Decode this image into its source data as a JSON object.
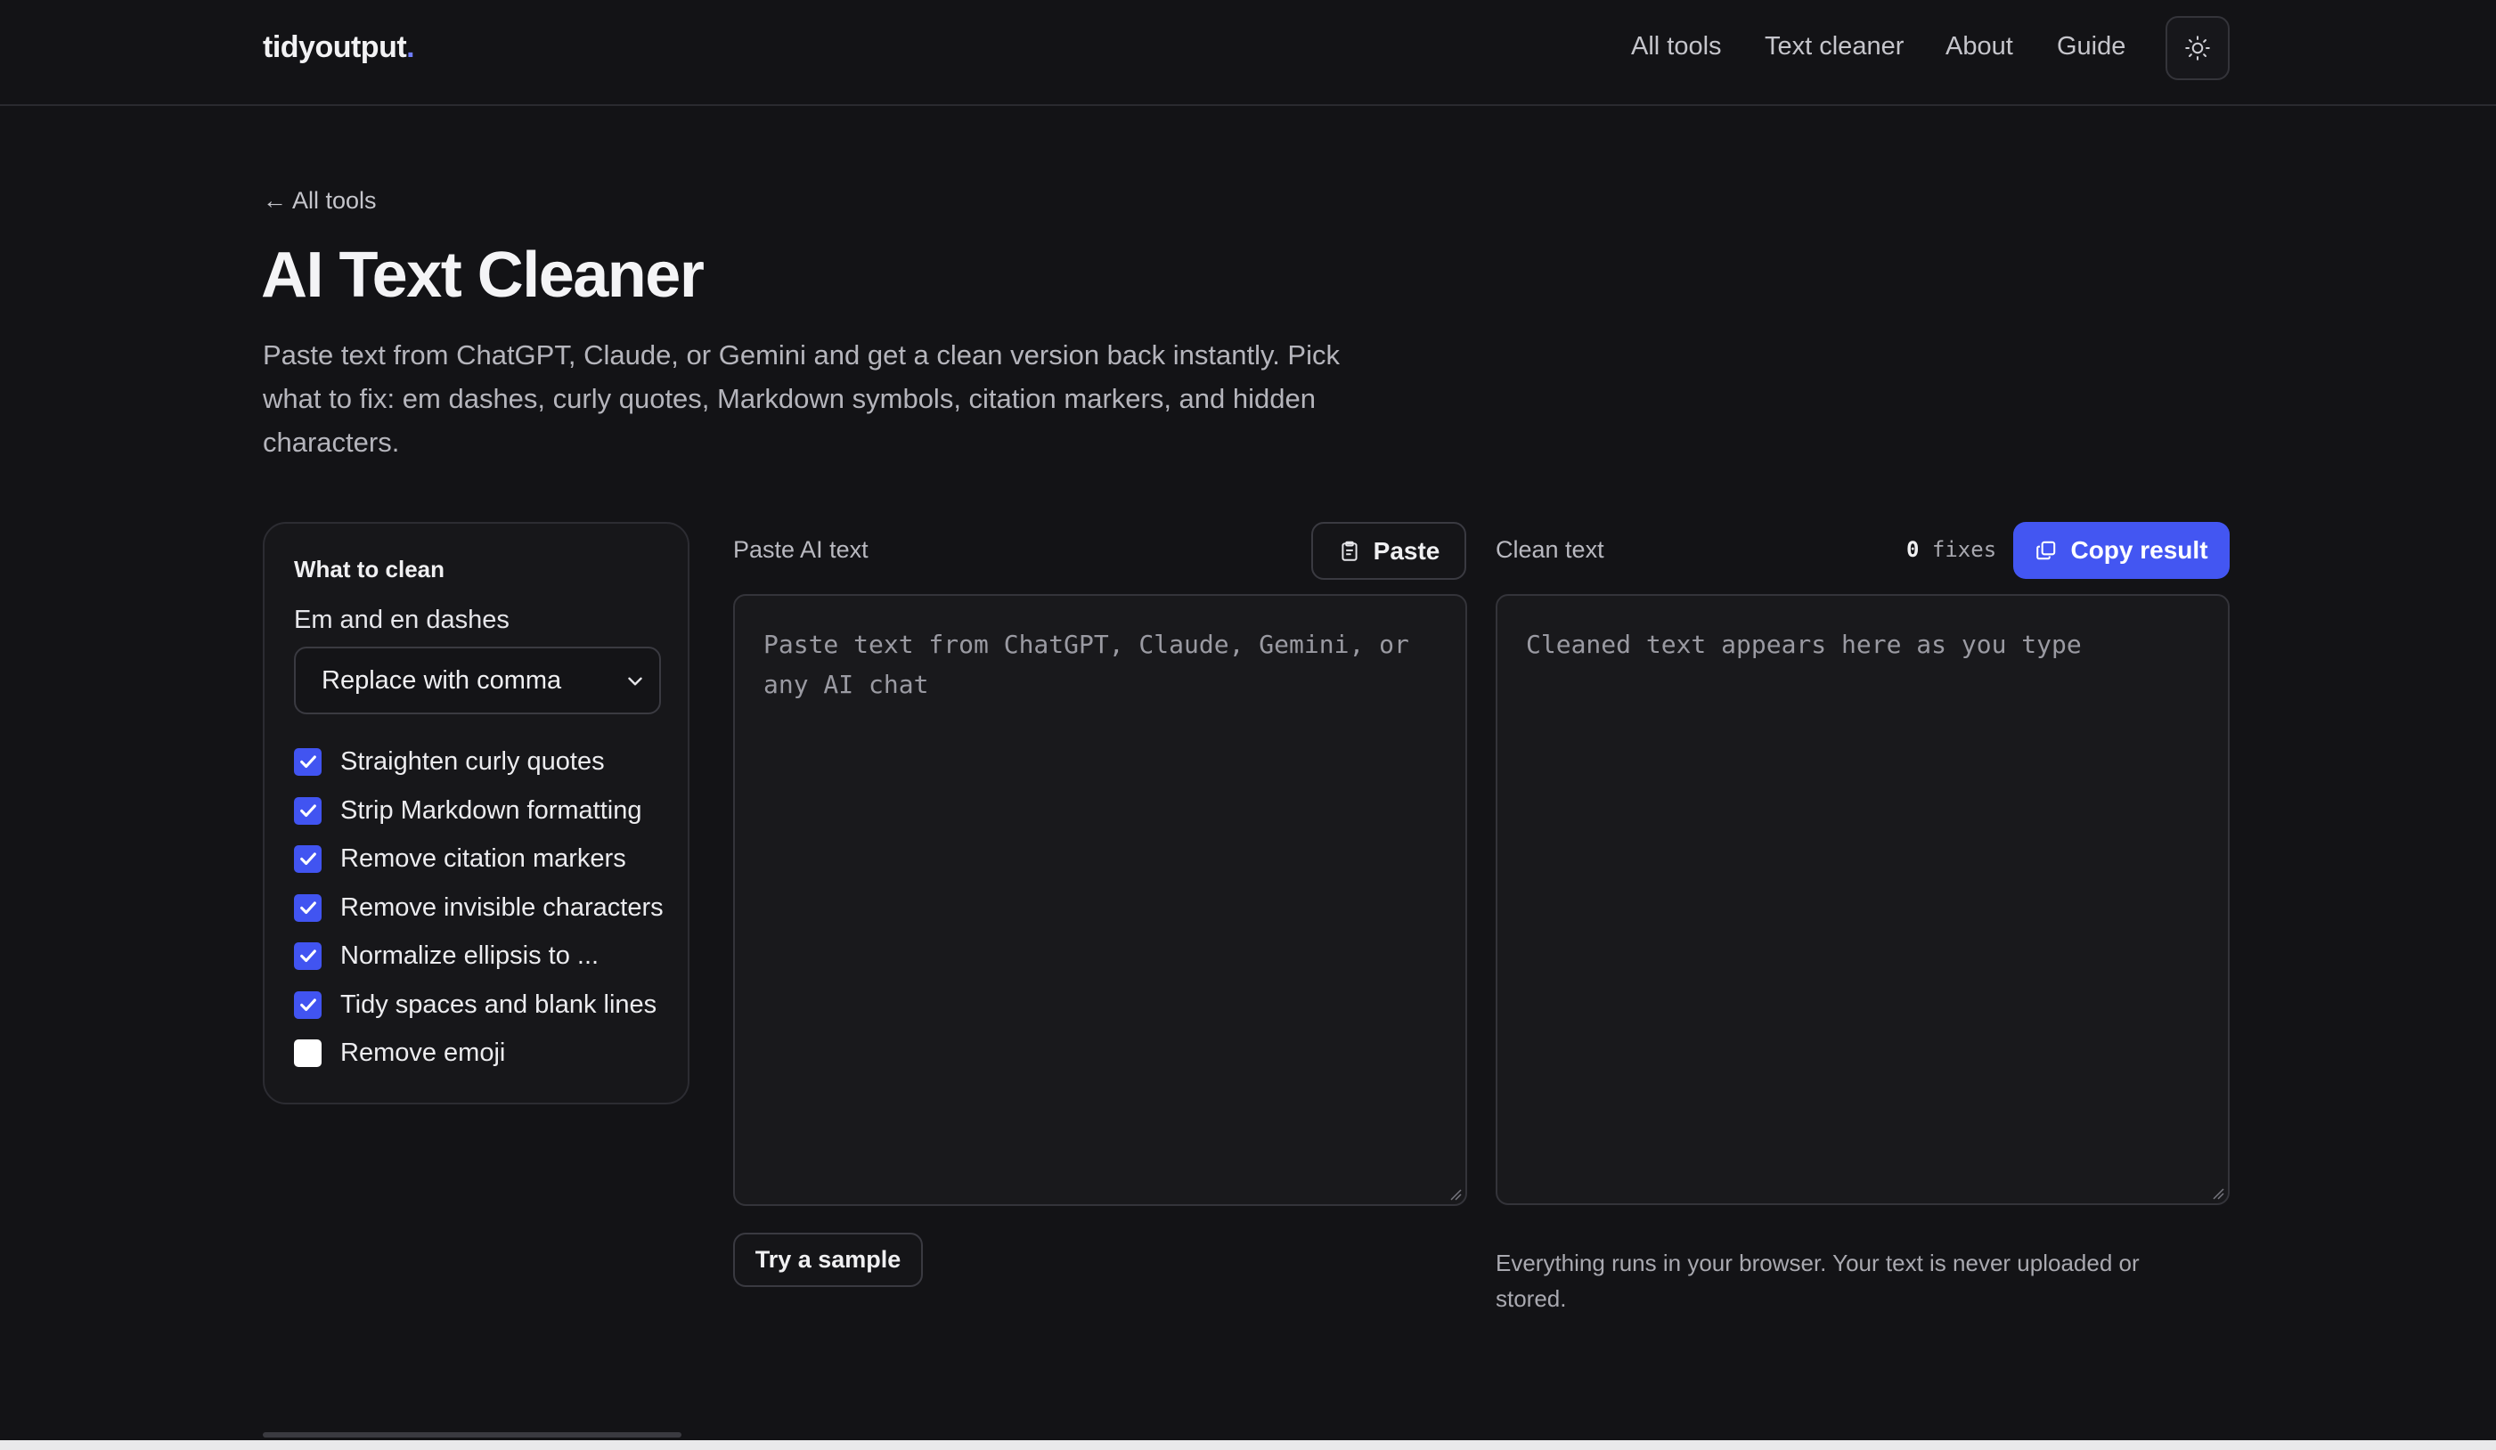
{
  "header": {
    "logo": "tidyoutput",
    "logo_dot": ".",
    "nav": [
      "All tools",
      "Text cleaner",
      "About",
      "Guide"
    ],
    "theme_toggle_icon": "sun-icon"
  },
  "intro": {
    "back_link": "← All tools",
    "title": "AI Text Cleaner",
    "description": "Paste text from ChatGPT, Claude, or Gemini and get a clean version back instantly. Pick what to fix: em dashes, curly quotes, Markdown symbols, citation markers, and hidden characters."
  },
  "options": {
    "heading": "What to clean",
    "dash_label": "Em and en dashes",
    "dash_selected": "Replace with comma",
    "items": [
      {
        "label": "Straighten curly quotes",
        "checked": true
      },
      {
        "label": "Strip Markdown formatting",
        "checked": true
      },
      {
        "label": "Remove citation markers",
        "checked": true
      },
      {
        "label": "Remove invisible characters",
        "checked": true
      },
      {
        "label": "Normalize ellipsis to ...",
        "checked": true
      },
      {
        "label": "Tidy spaces and blank lines",
        "checked": true
      },
      {
        "label": "Remove emoji",
        "checked": false
      }
    ]
  },
  "input": {
    "label": "Paste AI text",
    "paste_button": "Paste",
    "placeholder": "Paste text from ChatGPT, Claude, Gemini, or any AI chat",
    "sample_button": "Try a sample"
  },
  "output": {
    "label": "Clean text",
    "fixes_count": "0",
    "fixes_label": "fixes",
    "copy_button": "Copy result",
    "placeholder": "Cleaned text appears here as you type",
    "privacy_note": "Everything runs in your browser. Your text is never uploaded or stored."
  },
  "colors": {
    "background": "#131316",
    "accent": "#4356f2",
    "checkbox_checked": "#4154f1"
  }
}
